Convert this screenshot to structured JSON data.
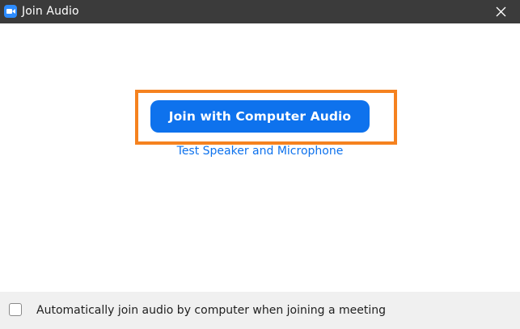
{
  "window": {
    "title": "Join Audio",
    "close_icon": "close-icon",
    "app_icon": "zoom-camera-icon"
  },
  "main": {
    "join_button_label": "Join with Computer Audio",
    "test_link_label": "Test Speaker and Microphone"
  },
  "footer": {
    "checkbox_checked": false,
    "checkbox_label": "Automatically join audio by computer when joining a meeting"
  },
  "colors": {
    "titlebar": "#3b3b3b",
    "accent": "#0e72ed",
    "highlight": "#f5821f",
    "footer_bg": "#f0f0f0"
  }
}
